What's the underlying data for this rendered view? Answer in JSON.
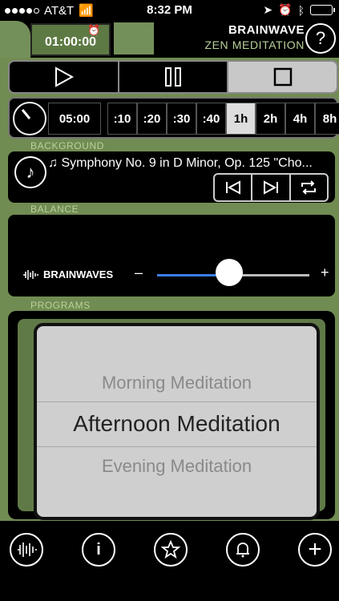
{
  "status_bar": {
    "carrier": "AT&T",
    "time": "8:32 PM"
  },
  "header": {
    "timer": "01:00:00",
    "brand_line1": "BRAINWAVE",
    "brand_line2": "ZEN MEDITATION",
    "help_label": "?"
  },
  "timer_row": {
    "duration": "05:00",
    "options": [
      ":10",
      ":20",
      ":30",
      ":40",
      "1h",
      "2h",
      "4h",
      "8h"
    ],
    "selected": "1h"
  },
  "labels": {
    "background": "BACKGROUND",
    "balance": "BALANCE",
    "programs": "PROGRAMS"
  },
  "background": {
    "track": "Symphony No. 9 in D Minor, Op. 125 \"Cho..."
  },
  "balance": {
    "left_label": "BRAINWAVES",
    "minus": "–",
    "plus": "+",
    "level": 0.48
  },
  "programs": {
    "items": [
      "Morning Meditation",
      "Afternoon Meditation",
      "Evening Meditation"
    ],
    "selected": "Afternoon Meditation"
  },
  "icons": {
    "bottom": [
      "waveform-icon",
      "info-icon",
      "star-icon",
      "bell-icon",
      "plus-icon"
    ]
  },
  "colors": {
    "frame_green": "#74905a",
    "accent_blue": "#3c7ff0"
  }
}
